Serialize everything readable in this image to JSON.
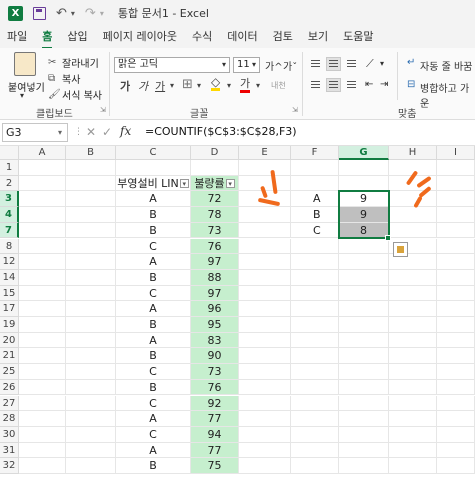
{
  "window": {
    "title": "통합 문서1  -  Excel"
  },
  "tabs": [
    {
      "label": "파일"
    },
    {
      "label": "홈",
      "active": true
    },
    {
      "label": "삽입"
    },
    {
      "label": "페이지 레이아웃"
    },
    {
      "label": "수식"
    },
    {
      "label": "데이터"
    },
    {
      "label": "검토"
    },
    {
      "label": "보기"
    },
    {
      "label": "도움말"
    }
  ],
  "ribbon": {
    "clipboard": {
      "paste_label": "붙여넣기",
      "cut_label": "잘라내기",
      "copy_label": "복사",
      "format_painter_label": "서식 복사",
      "group_label": "클립보드"
    },
    "font": {
      "font_name": "맑은 고딕",
      "font_size": "11",
      "grow_label": "가^",
      "shrink_label": "가ˇ",
      "bold_label": "가",
      "italic_label": "가",
      "underline_label": "가",
      "font_color_label": "가",
      "phonetic_label": "내천",
      "group_label": "글꼴"
    },
    "alignment": {
      "wrap_text_label": "자동 줄 바꿈",
      "merge_label": "병합하고 가운",
      "group_label": "맞춤"
    }
  },
  "formula_bar": {
    "name_box": "G3",
    "formula": "=COUNTIF($C$3:$C$28,F3)"
  },
  "grid": {
    "columns": [
      "A",
      "B",
      "C",
      "D",
      "E",
      "F",
      "G",
      "H",
      "I"
    ],
    "selected_column": "G",
    "header_row_label": "2",
    "header_c": "부영설비 LIN",
    "header_d": "불량률",
    "rows": [
      {
        "row": "3",
        "c": "A",
        "d": "72"
      },
      {
        "row": "4",
        "c": "B",
        "d": "78"
      },
      {
        "row": "7",
        "c": "B",
        "d": "73"
      },
      {
        "row": "8",
        "c": "C",
        "d": "76"
      },
      {
        "row": "12",
        "c": "A",
        "d": "97"
      },
      {
        "row": "14",
        "c": "B",
        "d": "88"
      },
      {
        "row": "15",
        "c": "C",
        "d": "97"
      },
      {
        "row": "17",
        "c": "A",
        "d": "96"
      },
      {
        "row": "19",
        "c": "B",
        "d": "95"
      },
      {
        "row": "20",
        "c": "A",
        "d": "83"
      },
      {
        "row": "21",
        "c": "B",
        "d": "90"
      },
      {
        "row": "25",
        "c": "C",
        "d": "73"
      },
      {
        "row": "26",
        "c": "B",
        "d": "76"
      },
      {
        "row": "27",
        "c": "C",
        "d": "92"
      },
      {
        "row": "28",
        "c": "A",
        "d": "77"
      },
      {
        "row": "30",
        "c": "C",
        "d": "94"
      },
      {
        "row": "31",
        "c": "A",
        "d": "77"
      },
      {
        "row": "32",
        "c": "B",
        "d": "75"
      }
    ],
    "summary": [
      {
        "f": "A",
        "g": "9"
      },
      {
        "f": "B",
        "g": "9"
      },
      {
        "f": "C",
        "g": "8"
      }
    ]
  },
  "colors": {
    "accent": "#107c41",
    "fill_green": "#c6efce",
    "annotation_orange": "#f06a1d"
  }
}
